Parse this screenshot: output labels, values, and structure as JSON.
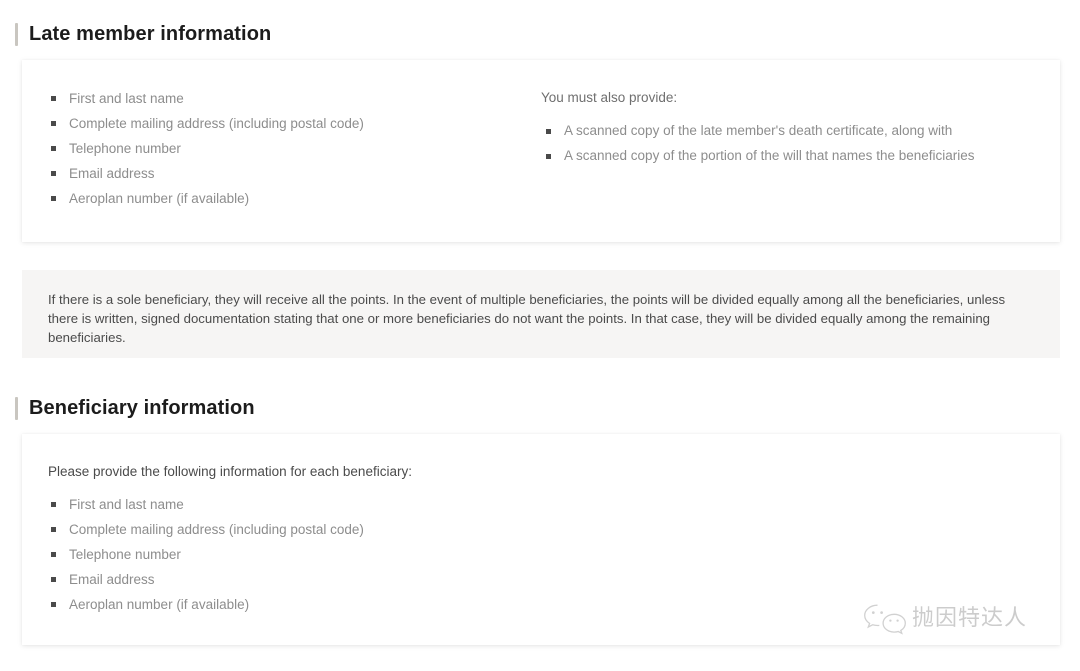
{
  "sections": {
    "late_member": {
      "heading": "Late member information",
      "left_list": [
        "First and last name",
        "Complete mailing address (including postal code)",
        "Telephone number",
        "Email address",
        "Aeroplan number (if available)"
      ],
      "right_label": "You must also provide:",
      "right_list": [
        "A scanned copy of the late member's death certificate, along with",
        "A scanned copy of the portion of the will that names the beneficiaries"
      ]
    },
    "callout": {
      "text": "If there is a sole beneficiary, they will receive all the points. In the event of multiple beneficiaries, the points will be divided equally among all the beneficiaries, unless there is written, signed documentation stating that one or more beneficiaries do not want the points. In that case, they will be divided equally among the remaining beneficiaries."
    },
    "beneficiary": {
      "heading": "Beneficiary information",
      "intro": "Please provide the following information for each beneficiary:",
      "list": [
        "First and last name",
        "Complete mailing address (including postal code)",
        "Telephone number",
        "Email address",
        "Aeroplan number (if available)"
      ]
    }
  },
  "watermark": {
    "icon": "wechat-icon",
    "text": "抛因特达人"
  },
  "colors": {
    "page_background": "#ffffff",
    "card_background": "#ffffff",
    "callout_background": "#f6f5f4",
    "heading_text": "#1c1c1c",
    "accent_bar": "#c9c6c0",
    "list_text": "#8d8d8d",
    "body_text": "#4b4b4b",
    "bullet": "#4a4a4a"
  }
}
